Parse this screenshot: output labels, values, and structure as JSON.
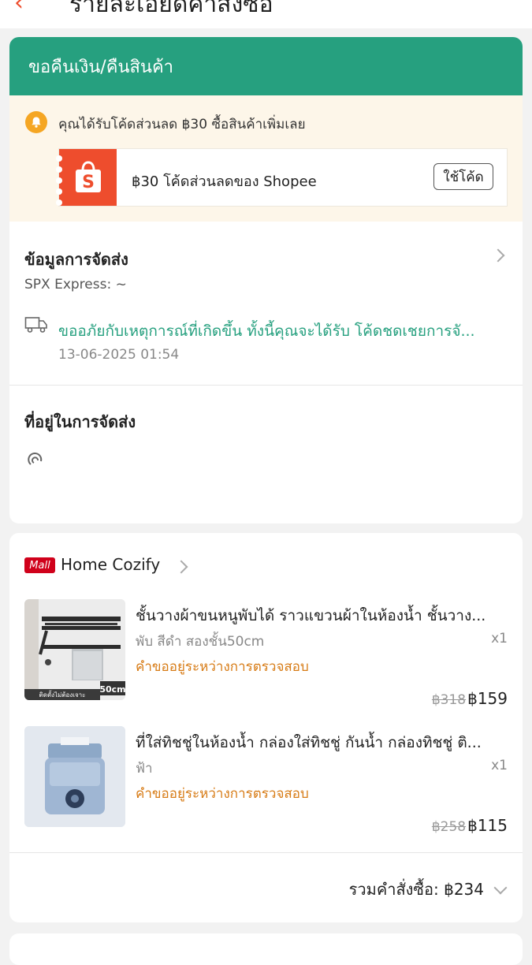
{
  "header": {
    "title": "รายละเอียดคำสั่งซื้อ"
  },
  "refund_banner": {
    "label": "ขอคืนเงิน/คืนสินค้า"
  },
  "voucher": {
    "message": "คุณได้รับโค้ดส่วนลด ฿30 ซื้อสินค้าเพิ่มเลย",
    "card_text": "฿30 โค้ดส่วนลดของ Shopee",
    "use_button": "ใช้โค้ด"
  },
  "shipping": {
    "title": "ข้อมูลการจัดส่ง",
    "carrier": "SPX Express: ~",
    "tracking_message": "ขออภัยกับเหตุการณ์ที่เกิดขึ้น ทั้งนี้คุณจะได้รับ โค้ดชดเชยการจั...",
    "tracking_time": "13-06-2025 01:54"
  },
  "address": {
    "title": "ที่อยู่ในการจัดส่ง"
  },
  "shop": {
    "badge": "Mall",
    "name": "Home Cozify"
  },
  "products": [
    {
      "title": "ชั้นวางผ้าขนหนูพับได้  ราวแขวนผ้าในห้องน้ำ ชั้นวาง...",
      "variant": "พับ สีดำ สองชั้น50cm",
      "qty": "x1",
      "status": "คำขออยู่ระหว่างการตรวจสอบ",
      "original_price": "฿318",
      "price": "฿159",
      "image_label": "50cm",
      "image_caption": "ติดตั้งไม่ต้องเจาะ"
    },
    {
      "title": "ที่ใส่ทิชชู่ในห้องน้ำ กล่องใส่ทิชชู่ กันน้ำ กล่องทิชชู่ ติ...",
      "variant": "ฟ้า",
      "qty": "x1",
      "status": "คำขออยู่ระหว่างการตรวจสอบ",
      "original_price": "฿258",
      "price": "฿115"
    }
  ],
  "order_total": {
    "text": "รวมคำสั่งซื้อ: ฿234"
  },
  "colors": {
    "green": "#26a07f",
    "shopee_orange": "#ee4d2d",
    "mall_red": "#d0011b",
    "status_orange": "#d77b15"
  }
}
